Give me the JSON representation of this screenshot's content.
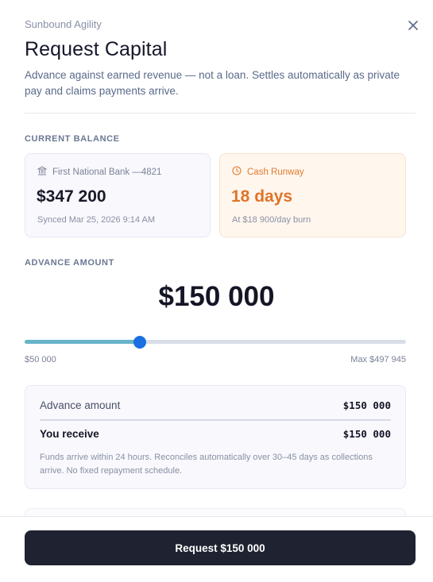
{
  "header": {
    "org_name": "Sunbound Agility",
    "title": "Request Capital",
    "subtitle": "Advance against earned revenue — not a loan. Settles automatically as private pay and claims payments arrive."
  },
  "current_balance": {
    "section_label": "CURRENT BALANCE",
    "bank_card": {
      "icon": "bank-icon",
      "label": "First National Bank —4821",
      "value": "$347 200",
      "sub": "Synced Mar 25, 2026 9:14 AM"
    },
    "runway_card": {
      "icon": "clock-icon",
      "label": "Cash Runway",
      "value": "18 days",
      "sub": "At $18 900/day burn"
    }
  },
  "advance": {
    "section_label": "ADVANCE AMOUNT",
    "amount_display": "$150 000",
    "slider": {
      "min": 50000,
      "max": 497945,
      "value": 150000
    },
    "min_label": "$50 000",
    "max_label": "Max $497 945"
  },
  "summary": {
    "advance_label": "Advance amount",
    "advance_value": "$150 000",
    "receive_label": "You receive",
    "receive_value": "$150 000",
    "note": "Funds arrive within 24 hours. Reconciles automatically over 30–45 days as collections arrive. No fixed repayment schedule."
  },
  "footer": {
    "cta_label": "Request $150 000"
  },
  "colors": {
    "primary_button": "#1f2230",
    "runway_accent": "#df7428",
    "slider_fill": "#67b3c7",
    "slider_thumb": "#1b6fe0"
  }
}
